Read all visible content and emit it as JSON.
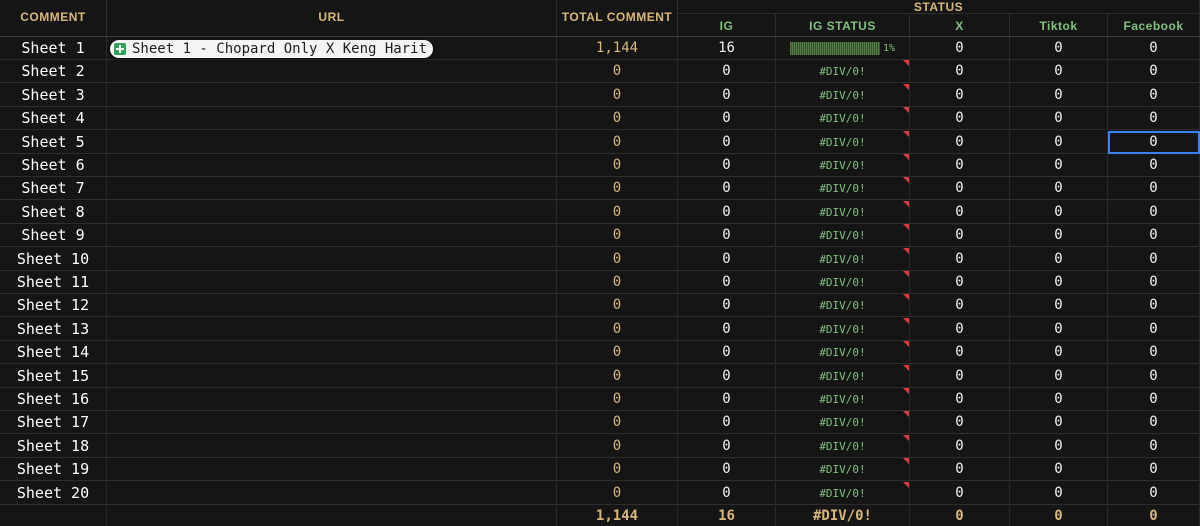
{
  "headers": {
    "comment": "COMMENT",
    "url": "URL",
    "total_comment": "TOTAL COMMENT",
    "status": "STATUS",
    "ig": "IG",
    "ig_status": "IG STATUS",
    "x": "X",
    "tiktok": "Tiktok",
    "facebook": "Facebook"
  },
  "rows": [
    {
      "name": "Sheet 1",
      "url_chip": "Sheet 1  - Chopard Only X Keng Harit",
      "url_tail": "a",
      "total": "1,144",
      "ig": "16",
      "ig_status_pct": "1%",
      "ig_status_fill": 0.01,
      "x": "0",
      "tiktok": "0",
      "facebook": "0"
    },
    {
      "name": "Sheet 2",
      "total": "0",
      "ig": "0",
      "ig_status": "#DIV/0!",
      "x": "0",
      "tiktok": "0",
      "facebook": "0"
    },
    {
      "name": "Sheet 3",
      "total": "0",
      "ig": "0",
      "ig_status": "#DIV/0!",
      "x": "0",
      "tiktok": "0",
      "facebook": "0"
    },
    {
      "name": "Sheet 4",
      "total": "0",
      "ig": "0",
      "ig_status": "#DIV/0!",
      "x": "0",
      "tiktok": "0",
      "facebook": "0"
    },
    {
      "name": "Sheet 5",
      "total": "0",
      "ig": "0",
      "ig_status": "#DIV/0!",
      "x": "0",
      "tiktok": "0",
      "facebook": "0",
      "selected": "facebook"
    },
    {
      "name": "Sheet 6",
      "total": "0",
      "ig": "0",
      "ig_status": "#DIV/0!",
      "x": "0",
      "tiktok": "0",
      "facebook": "0"
    },
    {
      "name": "Sheet 7",
      "total": "0",
      "ig": "0",
      "ig_status": "#DIV/0!",
      "x": "0",
      "tiktok": "0",
      "facebook": "0"
    },
    {
      "name": "Sheet 8",
      "total": "0",
      "ig": "0",
      "ig_status": "#DIV/0!",
      "x": "0",
      "tiktok": "0",
      "facebook": "0"
    },
    {
      "name": "Sheet 9",
      "total": "0",
      "ig": "0",
      "ig_status": "#DIV/0!",
      "x": "0",
      "tiktok": "0",
      "facebook": "0"
    },
    {
      "name": "Sheet 10",
      "total": "0",
      "ig": "0",
      "ig_status": "#DIV/0!",
      "x": "0",
      "tiktok": "0",
      "facebook": "0"
    },
    {
      "name": "Sheet 11",
      "total": "0",
      "ig": "0",
      "ig_status": "#DIV/0!",
      "x": "0",
      "tiktok": "0",
      "facebook": "0"
    },
    {
      "name": "Sheet 12",
      "total": "0",
      "ig": "0",
      "ig_status": "#DIV/0!",
      "x": "0",
      "tiktok": "0",
      "facebook": "0"
    },
    {
      "name": "Sheet 13",
      "total": "0",
      "ig": "0",
      "ig_status": "#DIV/0!",
      "x": "0",
      "tiktok": "0",
      "facebook": "0"
    },
    {
      "name": "Sheet 14",
      "total": "0",
      "ig": "0",
      "ig_status": "#DIV/0!",
      "x": "0",
      "tiktok": "0",
      "facebook": "0"
    },
    {
      "name": "Sheet 15",
      "total": "0",
      "ig": "0",
      "ig_status": "#DIV/0!",
      "x": "0",
      "tiktok": "0",
      "facebook": "0"
    },
    {
      "name": "Sheet 16",
      "total": "0",
      "ig": "0",
      "ig_status": "#DIV/0!",
      "x": "0",
      "tiktok": "0",
      "facebook": "0"
    },
    {
      "name": "Sheet 17",
      "total": "0",
      "ig": "0",
      "ig_status": "#DIV/0!",
      "x": "0",
      "tiktok": "0",
      "facebook": "0"
    },
    {
      "name": "Sheet 18",
      "total": "0",
      "ig": "0",
      "ig_status": "#DIV/0!",
      "x": "0",
      "tiktok": "0",
      "facebook": "0"
    },
    {
      "name": "Sheet 19",
      "total": "0",
      "ig": "0",
      "ig_status": "#DIV/0!",
      "x": "0",
      "tiktok": "0",
      "facebook": "0"
    },
    {
      "name": "Sheet 20",
      "total": "0",
      "ig": "0",
      "ig_status": "#DIV/0!",
      "x": "0",
      "tiktok": "0",
      "facebook": "0"
    }
  ],
  "totals": {
    "total": "1,144",
    "ig": "16",
    "ig_status": "#DIV/0!",
    "x": "0",
    "tiktok": "0",
    "facebook": "0"
  },
  "colors": {
    "header_tan": "#d9b77a",
    "header_green": "#7ec27e",
    "background": "#151515",
    "error_flag": "#e03a3a",
    "selection": "#3b82f6"
  },
  "icons": {
    "chip_icon": "sheets-icon"
  }
}
